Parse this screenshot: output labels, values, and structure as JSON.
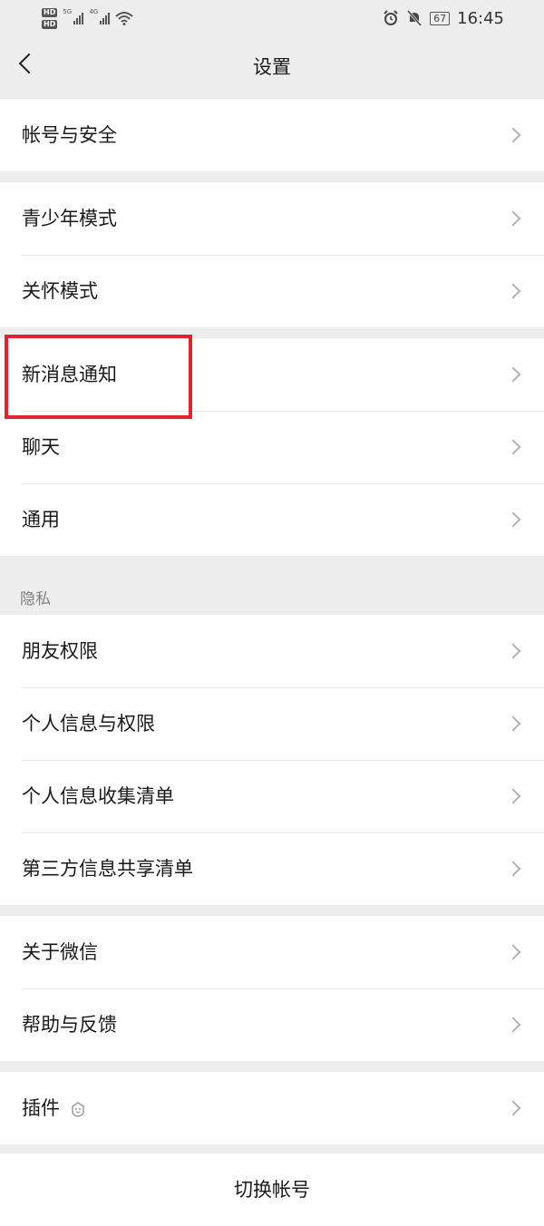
{
  "status_bar": {
    "time": "16:45",
    "battery": "67",
    "network_5g_label": "5G",
    "network_4g_label": "4G",
    "hd_label": "HD"
  },
  "nav": {
    "title": "设置"
  },
  "groups": [
    {
      "items": [
        {
          "label": "帐号与安全"
        }
      ]
    },
    {
      "items": [
        {
          "label": "青少年模式"
        },
        {
          "label": "关怀模式"
        }
      ]
    },
    {
      "items": [
        {
          "label": "新消息通知"
        },
        {
          "label": "聊天"
        },
        {
          "label": "通用"
        }
      ]
    },
    {
      "header": "隐私",
      "items": [
        {
          "label": "朋友权限"
        },
        {
          "label": "个人信息与权限"
        },
        {
          "label": "个人信息收集清单"
        },
        {
          "label": "第三方信息共享清单"
        }
      ]
    },
    {
      "items": [
        {
          "label": "关于微信"
        },
        {
          "label": "帮助与反馈"
        }
      ]
    },
    {
      "items": [
        {
          "label": "插件"
        }
      ]
    }
  ],
  "footer": {
    "switch_account": "切换帐号"
  },
  "colors": {
    "background": "#ededed",
    "cell": "#ffffff",
    "highlight": "#e0232f"
  }
}
